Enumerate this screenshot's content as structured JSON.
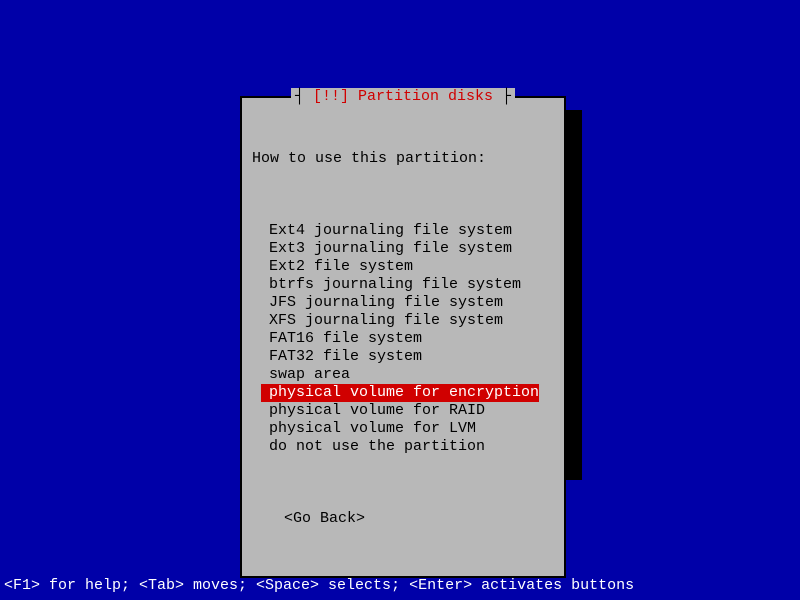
{
  "dialog": {
    "title": "[!!] Partition disks",
    "prompt": "How to use this partition:",
    "options": [
      {
        "label": "Ext4 journaling file system",
        "selected": false
      },
      {
        "label": "Ext3 journaling file system",
        "selected": false
      },
      {
        "label": "Ext2 file system",
        "selected": false
      },
      {
        "label": "btrfs journaling file system",
        "selected": false
      },
      {
        "label": "JFS journaling file system",
        "selected": false
      },
      {
        "label": "XFS journaling file system",
        "selected": false
      },
      {
        "label": "FAT16 file system",
        "selected": false
      },
      {
        "label": "FAT32 file system",
        "selected": false
      },
      {
        "label": "swap area",
        "selected": false
      },
      {
        "label": "physical volume for encryption",
        "selected": true
      },
      {
        "label": "physical volume for RAID",
        "selected": false
      },
      {
        "label": "physical volume for LVM",
        "selected": false
      },
      {
        "label": "do not use the partition",
        "selected": false
      }
    ],
    "go_back": "<Go Back>"
  },
  "status_bar": "<F1> for help; <Tab> moves; <Space> selects; <Enter> activates buttons"
}
